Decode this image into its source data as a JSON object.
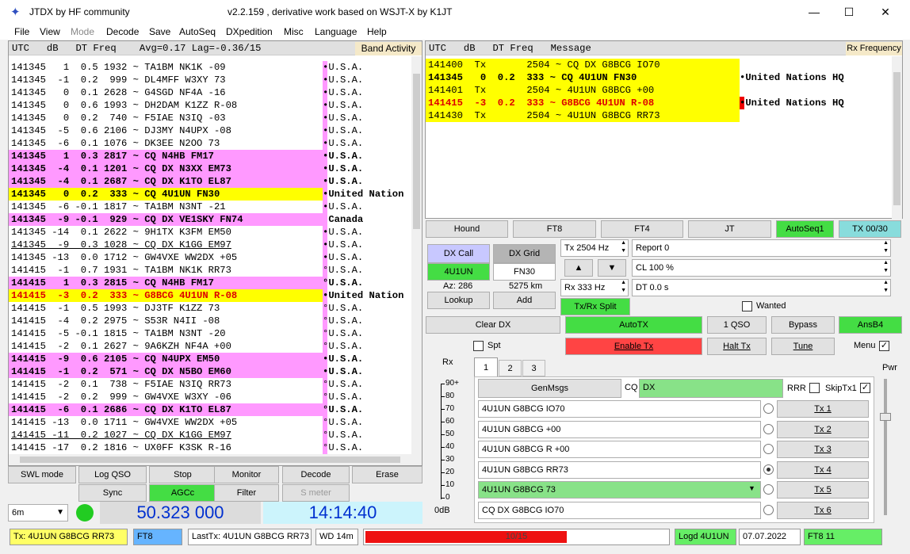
{
  "app": {
    "title": "JTDX  by HF community",
    "subtitle": "v2.2.159 , derivative work based on WSJT-X by K1JT",
    "min": "—",
    "max": "☐",
    "close": "✕"
  },
  "menu": [
    "File",
    "View",
    "Mode",
    "Decode",
    "Save",
    "AutoSeq",
    "DXpedition",
    "Misc",
    "Language",
    "Help"
  ],
  "band": {
    "header": "UTC   dB   DT Freq    Avg=0.17 Lag=-0.36/15",
    "label": "Band Activity",
    "rows": [
      {
        "t": "141345   1  0.5 1932 ~ TA1BM NK1K -09",
        "c": "•U.S.A.",
        "s": ""
      },
      {
        "t": "141345  -1  0.2  999 ~ DL4MFF W3XY 73",
        "c": "•U.S.A.",
        "s": ""
      },
      {
        "t": "141345   0  0.1 2628 ~ G4SGD NF4A -16",
        "c": "•U.S.A.",
        "s": ""
      },
      {
        "t": "141345   0  0.6 1993 ~ DH2DAM K1ZZ R-08",
        "c": "•U.S.A.",
        "s": ""
      },
      {
        "t": "141345   0  0.2  740 ~ F5IAE N3IQ -03",
        "c": "•U.S.A.",
        "s": ""
      },
      {
        "t": "141345  -5  0.6 2106 ~ DJ3MY N4UPX -08",
        "c": "•U.S.A.",
        "s": ""
      },
      {
        "t": "141345  -6  0.1 1076 ~ DK3EE N2OO 73",
        "c": "•U.S.A.",
        "s": ""
      },
      {
        "t": "141345   1  0.3 2817 ~ CQ N4HB FM17",
        "c": "•U.S.A.",
        "s": "pink"
      },
      {
        "t": "141345  -4  0.1 1201 ~ CQ DX N3XX EM73",
        "c": "•U.S.A.",
        "s": "pink"
      },
      {
        "t": "141345  -4  0.1 2687 ~ CQ DX K1TO EL87",
        "c": "•U.S.A.",
        "s": "pink"
      },
      {
        "t": "141345   0  0.2  333 ~ CQ 4U1UN FN30",
        "c": "•United Nation",
        "s": "yel"
      },
      {
        "t": "141345  -6 -0.1 1817 ~ TA1BM N3NT -21",
        "c": "•U.S.A.",
        "s": ""
      },
      {
        "t": "141345  -9 -0.1  929 ~ CQ DX VE1SKY FN74",
        "c": " Canada",
        "s": "pink"
      },
      {
        "t": "141345 -14  0.1 2622 ~ 9H1TX K3FM EM50",
        "c": "•U.S.A.",
        "s": ""
      },
      {
        "t": "141345  -9  0.3 1028 ~ CQ DX K1GG EM97",
        "c": "•U.S.A.",
        "s": "ul"
      },
      {
        "t": "141345 -13  0.0 1712 ~ GW4VXE WW2DX +05",
        "c": "•U.S.A.",
        "s": ""
      },
      {
        "t": "141415  -1  0.7 1931 ~ TA1BM NK1K RR73",
        "c": "°U.S.A.",
        "s": ""
      },
      {
        "t": "141415   1  0.3 2815 ~ CQ N4HB FM17",
        "c": "°U.S.A.",
        "s": "pink"
      },
      {
        "t": "141415  -3  0.2  333 ~ G8BCG 4U1UN R-08",
        "c": "•United Nation",
        "s": "yelred"
      },
      {
        "t": "141415  -1  0.5 1993 ~ DJ3TF K1ZZ 73",
        "c": "°U.S.A.",
        "s": ""
      },
      {
        "t": "141415  -4  0.2 2975 ~ S53R N4II -08",
        "c": "°U.S.A.",
        "s": ""
      },
      {
        "t": "141415  -5 -0.1 1815 ~ TA1BM N3NT -20",
        "c": "°U.S.A.",
        "s": ""
      },
      {
        "t": "141415  -2  0.1 2627 ~ 9A6KZH NF4A +00",
        "c": "°U.S.A.",
        "s": ""
      },
      {
        "t": "141415  -9  0.6 2105 ~ CQ N4UPX EM50",
        "c": "•U.S.A.",
        "s": "pink"
      },
      {
        "t": "141415  -1  0.2  571 ~ CQ DX N5BO EM60",
        "c": "•U.S.A.",
        "s": "pink"
      },
      {
        "t": "141415  -2  0.1  738 ~ F5IAE N3IQ RR73",
        "c": "°U.S.A.",
        "s": ""
      },
      {
        "t": "141415  -2  0.2  999 ~ GW4VXE W3XY -06",
        "c": "°U.S.A.",
        "s": ""
      },
      {
        "t": "141415  -6  0.1 2686 ~ CQ DX K1TO EL87",
        "c": "°U.S.A.",
        "s": "pink"
      },
      {
        "t": "141415 -13  0.0 1711 ~ GW4VXE WW2DX +05",
        "c": "°U.S.A.",
        "s": ""
      },
      {
        "t": "141415 -11  0.2 1027 ~ CQ DX K1GG EM97",
        "c": "°U.S.A.",
        "s": "ul"
      },
      {
        "t": "141415 -17  0.2 1816 ~ UX0FF K3SK R-16",
        "c": "°U.S.A.",
        "s": ""
      }
    ]
  },
  "rx": {
    "header": "UTC   dB   DT Freq   Message",
    "label": "Rx Frequency",
    "rows": [
      {
        "t": "141400  Tx       2504 ~ CQ DX G8BCG IO70",
        "c": "",
        "s": ""
      },
      {
        "t": "141345   0  0.2  333 ~ CQ 4U1UN FN30",
        "c": "•United Nations HQ",
        "s": "b"
      },
      {
        "t": "141401  Tx       2504 ~ 4U1UN G8BCG +00",
        "c": "",
        "s": ""
      },
      {
        "t": "141415  -3  0.2  333 ~ G8BCG 4U1UN R-08",
        "c": "•United Nations HQ",
        "s": "red"
      },
      {
        "t": "141430  Tx       2504 ~ 4U1UN G8BCG RR73",
        "c": "",
        "s": ""
      }
    ]
  },
  "left_buttons": {
    "swl": "SWL mode",
    "logqso": "Log QSO",
    "stop": "Stop",
    "monitor": "Monitor",
    "decode": "Decode",
    "erase": "Erase",
    "sync": "Sync",
    "agcc": "AGCc",
    "filter": "Filter",
    "smeter": "S meter"
  },
  "band_select": "6m",
  "freq": "50.323 000",
  "clock": "14:14:40",
  "modes": {
    "hound": "Hound",
    "ft8": "FT8",
    "ft4": "FT4",
    "jt": "JT",
    "autoseq": "AutoSeq1",
    "tx0030": "TX 00/30"
  },
  "dx": {
    "call_label": "DX Call",
    "grid_label": "DX Grid",
    "call": "4U1UN",
    "grid": "FN30",
    "az": "Az: 286",
    "dist": "5275 km",
    "lookup": "Lookup",
    "add": "Add"
  },
  "tx_freq": "Tx  2504  Hz",
  "rx_freq": "Rx  333  Hz",
  "txrx_split": "Tx/Rx Split",
  "up": "▲",
  "down": "▼",
  "report": "Report 0",
  "cl": "CL  100 %",
  "dt": "DT 0.0 s",
  "wanted": "Wanted",
  "ctrl": {
    "clear": "Clear DX",
    "autotx": "AutoTX",
    "oneqso": "1 QSO",
    "bypass": "Bypass",
    "ansb4": "AnsB4",
    "spt": "Spt",
    "enable": "Enable Tx",
    "halt": "Halt Tx",
    "tune": "Tune",
    "menu": "Menu"
  },
  "meter": {
    "label": "Rx",
    "unit": "0dB",
    "ticks": [
      "90+",
      "80",
      "70",
      "60",
      "50",
      "40",
      "30",
      "20",
      "10",
      "0"
    ]
  },
  "tabs": [
    "1",
    "2",
    "3"
  ],
  "genmsgs": "GenMsgs",
  "cq": "CQ",
  "cq_val": "DX",
  "rrr": "RRR",
  "skiptx1": "SkipTx1",
  "pwr": "Pwr",
  "messages": [
    {
      "text": "4U1UN G8BCG IO70",
      "btn": "Tx 1",
      "sel": false
    },
    {
      "text": "4U1UN G8BCG +00",
      "btn": "Tx 2",
      "sel": false
    },
    {
      "text": "4U1UN G8BCG R +00",
      "btn": "Tx 3",
      "sel": false
    },
    {
      "text": "4U1UN G8BCG RR73",
      "btn": "Tx 4",
      "sel": true
    },
    {
      "text": "4U1UN G8BCG 73",
      "btn": "Tx 5",
      "sel": false
    },
    {
      "text": "CQ DX G8BCG IO70",
      "btn": "Tx 6",
      "sel": false
    }
  ],
  "status": {
    "tx": "Tx: 4U1UN G8BCG RR73",
    "mode": "FT8",
    "lasttx": "LastTx: 4U1UN G8BCG RR73",
    "wd": "WD 14m",
    "progress_text": "10/15",
    "progress": 0.6667,
    "logd": "Logd 4U1UN",
    "date": "07.07.2022",
    "ftcount": "FT8  11"
  },
  "colors": {
    "pink": "#ff99ff",
    "yellow": "#ffff00",
    "green": "#44dd44",
    "red": "#ff4444",
    "blue_freq": "#0030d0"
  }
}
